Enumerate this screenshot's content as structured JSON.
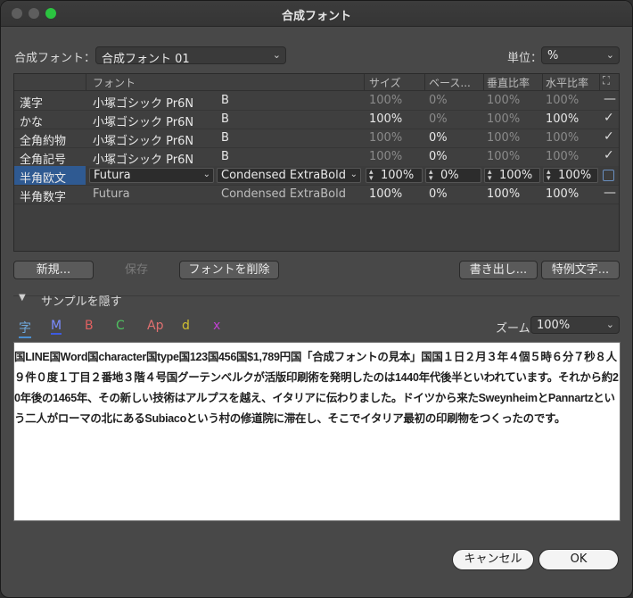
{
  "window": {
    "title": "合成フォント"
  },
  "top": {
    "composite_label": "合成フォント：",
    "composite_value": "合成フォント 01",
    "unit_label": "単位：",
    "unit_value": "%"
  },
  "table": {
    "headers": [
      "フォント",
      "サイズ",
      "ベース...",
      "垂直比率",
      "水平比率"
    ],
    "rows": [
      {
        "name": "漢字",
        "font": "小塚ゴシック Pr6N",
        "style": "B",
        "size": "100%",
        "base": "0%",
        "vscale": "100%",
        "hscale": "100%",
        "mark": "—"
      },
      {
        "name": "かな",
        "font": "小塚ゴシック Pr6N",
        "style": "B",
        "size": "100%",
        "base": "0%",
        "vscale": "100%",
        "hscale": "100%",
        "mark": "✓"
      },
      {
        "name": "全角約物",
        "font": "小塚ゴシック Pr6N",
        "style": "B",
        "size": "100%",
        "base": "0%",
        "vscale": "100%",
        "hscale": "100%",
        "mark": "✓"
      },
      {
        "name": "全角記号",
        "font": "小塚ゴシック Pr6N",
        "style": "B",
        "size": "100%",
        "base": "0%",
        "vscale": "100%",
        "hscale": "100%",
        "mark": "✓"
      },
      {
        "name": "半角欧文",
        "font": "Futura",
        "style": "Condensed ExtraBold",
        "size": "100%",
        "base": "0%",
        "vscale": "100%",
        "hscale": "100%",
        "mark": ""
      },
      {
        "name": "半角数字",
        "font": "Futura",
        "style": "Condensed ExtraBold",
        "size": "100%",
        "base": "0%",
        "vscale": "100%",
        "hscale": "100%",
        "mark": "—"
      }
    ]
  },
  "buttons": {
    "new": "新規...",
    "save": "保存",
    "delete_font": "フォントを削除",
    "export": "書き出し...",
    "special": "特例文字...",
    "cancel": "キャンセル",
    "ok": "OK"
  },
  "sample_section": {
    "toggle_label": "サンプルを隠す",
    "zoom_label": "ズーム",
    "zoom_value": "100%",
    "icon_glyphs": [
      "字",
      "M",
      "B",
      "C",
      "Ap",
      "d",
      "x"
    ],
    "text": "国LINE国Word国character国type国123国456国$1,789円国「合成フォントの見本」国国１日２月３年４個５時６分７秒８人９件０度１丁目２番地３階４号国グーテンベルクが活版印刷術を発明したのは1440年代後半といわれています。それから約20年後の1465年、その新しい技術はアルプスを越え、イタリアに伝わりました。ドイツから来たSweynheimとPannartzという二人がローマの北にあるSubiacoという村の修道院に滞在し、そこでイタリア最初の印刷物をつくったのです。"
  },
  "colors": {
    "selection": "#2f5a92",
    "ok_button": "#f4f4f4",
    "close_light": "#2bc340"
  }
}
